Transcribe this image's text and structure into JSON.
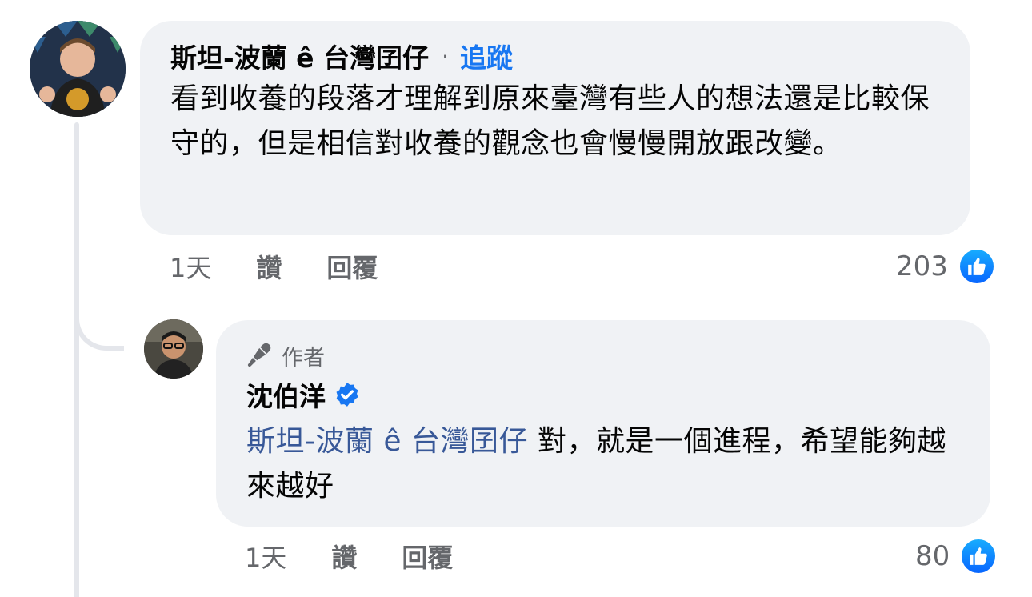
{
  "comment": {
    "author": "斯坦-波蘭 ê 台灣囝仔",
    "separator": "·",
    "follow_label": "追蹤",
    "text": "看到收養的段落才理解到原來臺灣有些人的想法還是比較保守的，但是相信對收養的觀念也會慢慢開放跟改變。",
    "time": "1天",
    "like_label": "讚",
    "reply_label": "回覆",
    "reaction_count": "203"
  },
  "reply": {
    "badge_label": "作者",
    "author": "沈伯洋",
    "mention": "斯坦-波蘭 ê 台灣囝仔",
    "text": " 對，就是一個進程，希望能夠越來越好",
    "time": "1天",
    "like_label": "讚",
    "reply_label": "回覆",
    "reaction_count": "80"
  },
  "icons": {
    "author_badge": "microphone-icon",
    "verified": "verified-badge-icon",
    "reaction": "like-thumb-icon"
  },
  "colors": {
    "bubble": "#f0f2f5",
    "link_blue": "#1877f2",
    "mention": "#385898",
    "meta_gray": "#65676b",
    "like_blue": "#0866ff"
  }
}
